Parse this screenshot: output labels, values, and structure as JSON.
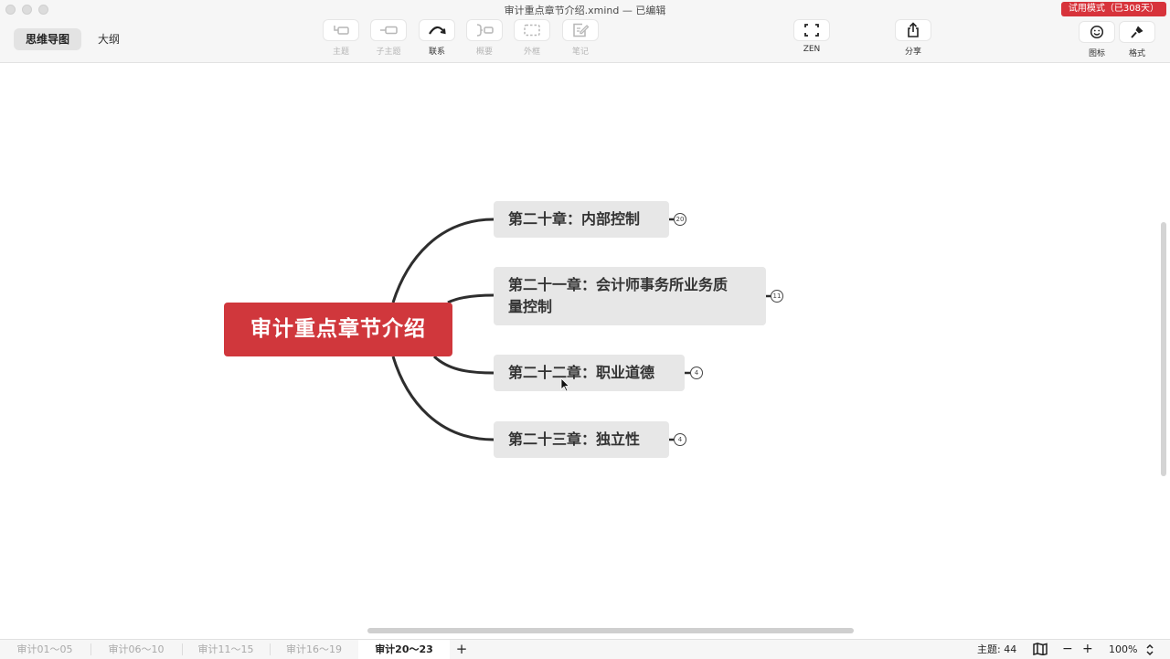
{
  "window": {
    "title": "审计重点章节介绍.xmind — 已编辑",
    "trial_badge": "试用模式（已308天）"
  },
  "view_tabs": [
    {
      "label": "思维导图",
      "active": true
    },
    {
      "label": "大纲",
      "active": false
    }
  ],
  "toolbar": {
    "topic": "主题",
    "subtopic": "子主题",
    "relationship": "联系",
    "summary": "概要",
    "boundary": "外框",
    "notes": "笔记",
    "zen": "ZEN",
    "share": "分享",
    "icons": "图标",
    "format": "格式"
  },
  "mindmap": {
    "central_topic": "审计重点章节介绍",
    "colors": {
      "central": "#d0373c",
      "topic_bg": "#e7e7e7",
      "line": "#2e2e2e"
    },
    "topics": [
      {
        "line1": "第二十章：内部控制",
        "line2": "",
        "count": "20"
      },
      {
        "line1": "第二十一章：会计师事务所业务质",
        "line2": "量控制",
        "count": "11"
      },
      {
        "line1": "第二十二章：职业道德",
        "line2": "",
        "count": "4"
      },
      {
        "line1": "第二十三章：独立性",
        "line2": "",
        "count": "4"
      }
    ]
  },
  "sheets": [
    {
      "label": "审计01～05",
      "active": false
    },
    {
      "label": "审计06～10",
      "active": false
    },
    {
      "label": "审计11～15",
      "active": false
    },
    {
      "label": "审计16～19",
      "active": false
    },
    {
      "label": "审计20～23",
      "active": true
    }
  ],
  "add_sheet": "+",
  "status": {
    "topic_count": "主题: 44",
    "zoom_out": "−",
    "zoom_in": "+",
    "zoom": "100%"
  }
}
